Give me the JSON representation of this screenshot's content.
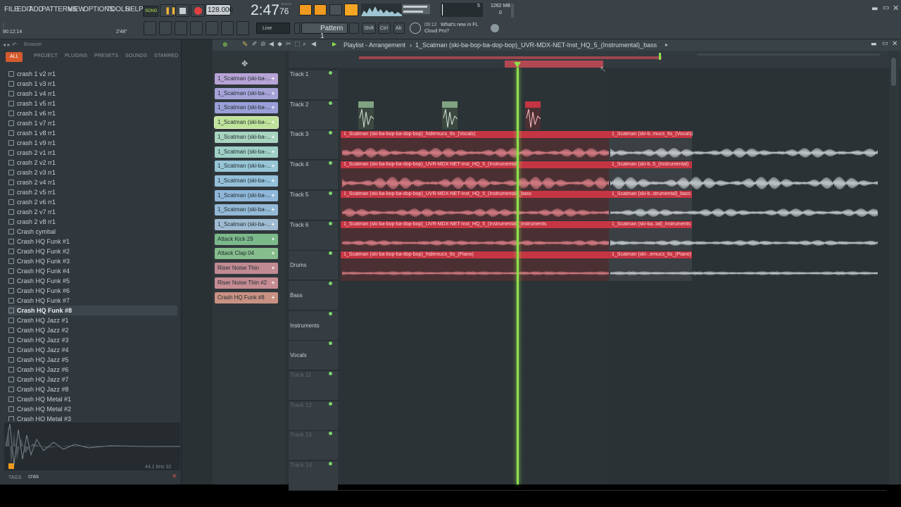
{
  "menu": [
    "FILE",
    "EDIT",
    "ADD",
    "PATTERNS",
    "VIEW",
    "OPTIONS",
    "TOOLS",
    "HELP"
  ],
  "transport": {
    "mode": "SONG",
    "tempo": "128.000",
    "time": "2:47",
    "time_sub": "76",
    "time_unit": "M:S:CS",
    "cpu": "5",
    "ram": "1262 MB",
    "ram_sub": "0"
  },
  "hint": {
    "position": "90:12:14",
    "duration": "2'48\""
  },
  "toolbar": {
    "snap": "Line",
    "pattern": "Pattern 1",
    "shift": "Shift",
    "ctrl": "Ctrl",
    "alt": "Alt",
    "news_time": "09:12",
    "news_line1": "What's new in FL",
    "news_line2": "Cloud Pro?"
  },
  "browser": {
    "title": "Browser",
    "tabs": [
      "ALL",
      "PROJECT",
      "PLUGINS",
      "PRESETS",
      "SOUNDS",
      "STARRED"
    ],
    "items": [
      "crash 1 v2 rr1",
      "crash 1 v3 rr1",
      "crash 1 v4 rr1",
      "crash 1 v5 rr1",
      "crash 1 v6 rr1",
      "crash 1 v7 rr1",
      "crash 1 v8 rr1",
      "crash 1 v9 rr1",
      "crash 2 v1 rr1",
      "crash 2 v2 rr1",
      "crash 2 v3 rr1",
      "crash 2 v4 rr1",
      "crash 2 v5 rr1",
      "crash 2 v6 rr1",
      "crash 2 v7 rr1",
      "crash 2 v8 rr1",
      "Crash cymbal",
      "Crash HQ Funk #1",
      "Crash HQ Funk #2",
      "Crash HQ Funk #3",
      "Crash HQ Funk #4",
      "Crash HQ Funk #5",
      "Crash HQ Funk #6",
      "Crash HQ Funk #7",
      "Crash HQ Funk #8",
      "Crash HQ Jazz #1",
      "Crash HQ Jazz #2",
      "Crash HQ Jazz #3",
      "Crash HQ Jazz #4",
      "Crash HQ Jazz #5",
      "Crash HQ Jazz #6",
      "Crash HQ Jazz #7",
      "Crash HQ Jazz #8",
      "Crash HQ Metal #1",
      "Crash HQ Metal #2",
      "Crash HQ Metal #3"
    ],
    "selected_index": 24,
    "sample_info": "44.1 kHz 32",
    "tags_label": "TAGS",
    "search_value": "cras"
  },
  "playlist": {
    "title": "Playlist - Arrangement",
    "arrangement": "1_Scatman (ski-ba-bop-ba-dop-bop)_UVR-MDX-NET-Inst_HQ_5_(Instrumental)_bass"
  },
  "patterns": [
    {
      "label": "1_Scatman (ski-ba-...",
      "color": "#b8a3d6"
    },
    {
      "label": "1_Scatman (ski-ba-...",
      "color": "#a6a3d9"
    },
    {
      "label": "1_Scatman (ski-ba-...",
      "color": "#9a9fd8"
    },
    {
      "label": "1_Scatman (ski-ba-...",
      "color": "#bfe39a"
    },
    {
      "label": "1_Scatman (ski-ba-...",
      "color": "#a8d4c0"
    },
    {
      "label": "1_Scatman (ski-ba-...",
      "color": "#9fd0c6"
    },
    {
      "label": "1_Scatman (ski-ba-...",
      "color": "#97c6d6"
    },
    {
      "label": "1_Scatman (ski-ba-...",
      "color": "#94c0da"
    },
    {
      "label": "1_Scatman (ski-ba-...",
      "color": "#8fb7d9"
    },
    {
      "label": "1_Scatman (ski-ba-...",
      "color": "#94b9d6"
    },
    {
      "label": "1_Scatman (ski-ba-...",
      "color": "#a0bcd2"
    },
    {
      "label": "Attack Kick 29",
      "color": "#7cb98a"
    },
    {
      "label": "Attack Clap 04",
      "color": "#86bd8c"
    },
    {
      "label": "Riser Noise Thin",
      "color": "#c08a93"
    },
    {
      "label": "Riser Noise Thin #2",
      "color": "#c58c93"
    },
    {
      "label": "Crash HQ Funk #8",
      "color": "#c89183"
    }
  ],
  "tracks": [
    "Track 1",
    "Track 2",
    "Track 3",
    "Track 4",
    "Track 5",
    "Track 6",
    "Drums",
    "Bass",
    "Instruments",
    "Vocals",
    "Track 11",
    "Track 12",
    "Track 13",
    "Track 14"
  ],
  "clips": [
    {
      "main": "1_Scatman (ski-ba-bop-ba-dop-bop)_htdemucs_6s_(Vocals)",
      "tail": "1_Scatman (ski-b..mucs_6s_(Vocals)"
    },
    {
      "main": "1_Scatman (ski-ba-bop-ba-dop-bop)_UVR-MDX-NET-Inst_HQ_5_(Instrumental)",
      "tail": "1_Scatman (ski-b..5_(Instrumental)"
    },
    {
      "main": "1_Scatman (ski-ba-bop-ba-dop-bop)_UVR-MDX-NET-Inst_HQ_5_(Instrumental)_bass",
      "tail": "1_Scatman (ski-b..strumental)_bass"
    },
    {
      "main": "1_Scatman (ski-ba-bop-ba-dop-bop)_UVR-MDX-NET-Inst_HQ_5_(Instrumental)_instruments",
      "tail": "1_Scatman (ski-ba..tal)_instruments"
    },
    {
      "main": "1_Scatman (ski-ba-bop-ba-dop-bop)_htdemucs_6s_(Piano)",
      "tail": "1_Scatman (ski-..emucs_6s_(Piano)"
    }
  ],
  "colors": {
    "accent": "#f5a524",
    "clip_red": "#c53543",
    "playhead": "#8fe04c"
  }
}
